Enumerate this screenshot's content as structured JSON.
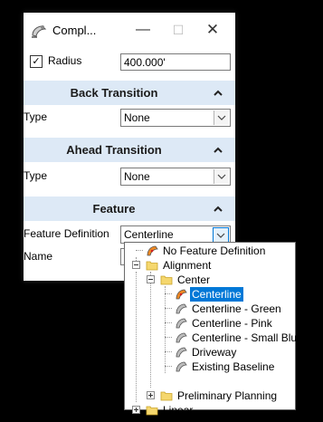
{
  "window": {
    "title": "Compl...",
    "minimize_glyph": "—",
    "maximize_glyph": "☐",
    "close_glyph": "✕"
  },
  "radius": {
    "checked": true,
    "label": "Radius",
    "value": "400.000'"
  },
  "back_transition": {
    "title": "Back Transition",
    "type_label": "Type",
    "type_value": "None"
  },
  "ahead_transition": {
    "title": "Ahead Transition",
    "type_label": "Type",
    "type_value": "None"
  },
  "feature": {
    "title": "Feature",
    "definition_label": "Feature Definition",
    "definition_value": "Centerline",
    "name_label": "Name"
  },
  "tree": {
    "items": [
      {
        "label": "No Feature Definition",
        "icon": "feature-icon"
      },
      {
        "label": "Alignment",
        "icon": "folder-icon",
        "expanded": true
      },
      {
        "label": "Center",
        "icon": "folder-icon",
        "expanded": true
      },
      {
        "label": "Centerline",
        "icon": "feature-icon",
        "selected": true
      },
      {
        "label": "Centerline - Green",
        "icon": "feature-gray-icon"
      },
      {
        "label": "Centerline - Pink",
        "icon": "feature-gray-icon"
      },
      {
        "label": "Centerline - Small Blue",
        "icon": "feature-gray-icon"
      },
      {
        "label": "Driveway",
        "icon": "feature-gray-icon"
      },
      {
        "label": "Existing Baseline",
        "icon": "feature-gray-icon"
      },
      {
        "label": "Preliminary Planning",
        "icon": "folder-icon",
        "expanded": false
      },
      {
        "label": "Linear",
        "icon": "folder-icon",
        "expanded": false
      }
    ]
  },
  "colors": {
    "section_header": "#dde9f6",
    "selection": "#0078d7",
    "folder": "#f5d76e"
  }
}
